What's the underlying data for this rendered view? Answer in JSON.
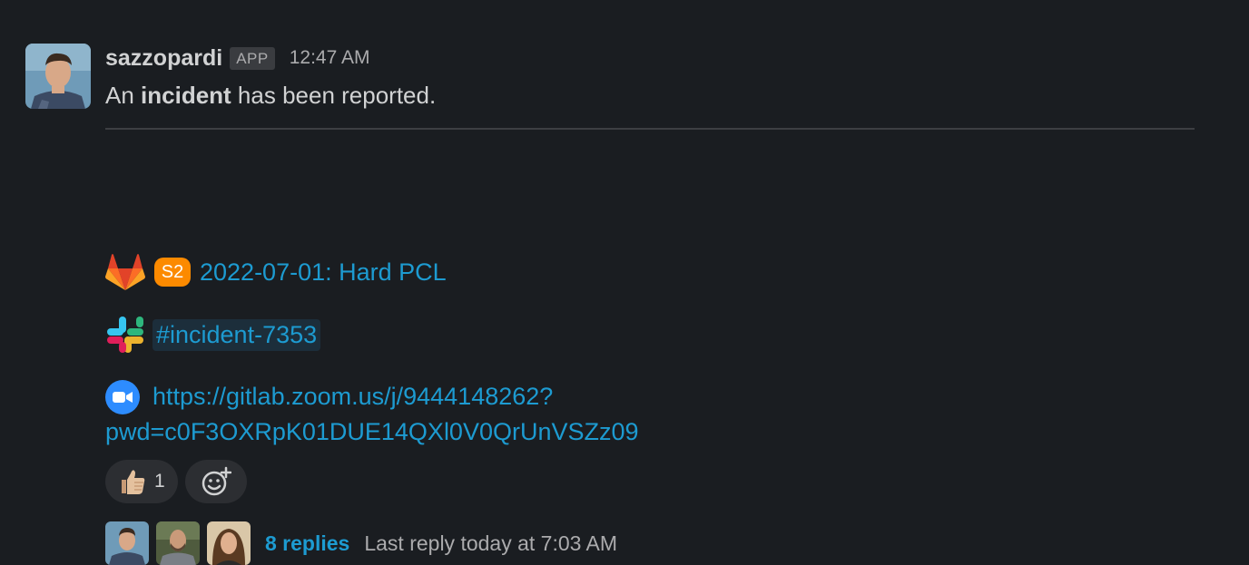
{
  "message": {
    "sender": "sazzopardi",
    "app_badge": "APP",
    "timestamp": "12:47 AM",
    "text_prefix": "An ",
    "text_bold": "incident",
    "text_suffix": " has been reported."
  },
  "incident": {
    "severity": "S2",
    "title_link": "2022-07-01: Hard PCL",
    "severity_color": "#fc8a00"
  },
  "channel": {
    "name": "#incident-7353"
  },
  "zoom": {
    "url_line1": "https://gitlab.zoom.us/j/9444148262?",
    "url_line2": "pwd=c0F3OXRpK01DUE14QXl0V0QrUnVSZz09"
  },
  "reactions": [
    {
      "emoji": "thumbs-up",
      "count": "1"
    }
  ],
  "thread": {
    "replies_label": "8 replies",
    "last_reply": "Last reply today at 7:03 AM"
  },
  "colors": {
    "background": "#1a1d21",
    "link": "#1d9bd1",
    "text": "#d1d2d3",
    "muted": "#ababad"
  }
}
